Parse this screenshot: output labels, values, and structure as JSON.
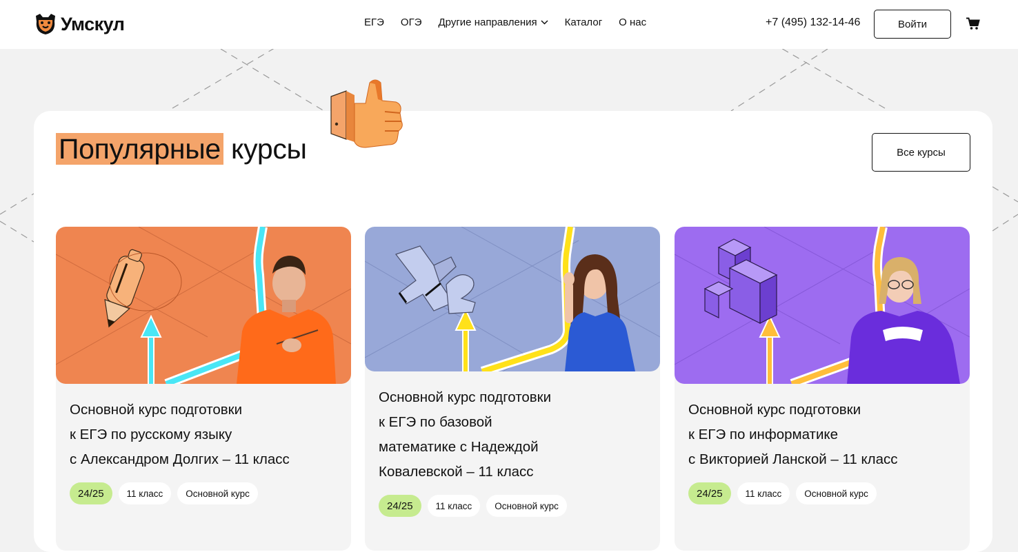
{
  "brand": {
    "name": "Умскул"
  },
  "nav": {
    "items": [
      "ЕГЭ",
      "ОГЭ",
      "Другие направления",
      "Каталог",
      "О нас"
    ]
  },
  "header": {
    "phone": "+7 (495) 132-14-46",
    "login_label": "Войти"
  },
  "section": {
    "title_highlight": "Популярные",
    "title_rest": "курсы",
    "all_courses_label": "Все курсы"
  },
  "courses": [
    {
      "title_lines": [
        "Основной курс подготовки",
        "к ЕГЭ по русскому языку",
        "с Александром Долгих – 11 класс"
      ],
      "tags": [
        "24/25",
        "11 класс",
        "Основной курс"
      ],
      "color": "#ef8550"
    },
    {
      "title_lines": [
        "Основной курс подготовки",
        "к ЕГЭ по базовой",
        "математике с Надеждой",
        "Ковалевской – 11 класс"
      ],
      "tags": [
        "24/25",
        "11 класс",
        "Основной курс"
      ],
      "color": "#98a8d8"
    },
    {
      "title_lines": [
        "Основной курс подготовки",
        "к ЕГЭ по информатике",
        "с Викторией Ланской – 11 класс"
      ],
      "tags": [
        "24/25",
        "11 класс",
        "Основной курс"
      ],
      "color": "#9d6cf0"
    }
  ]
}
